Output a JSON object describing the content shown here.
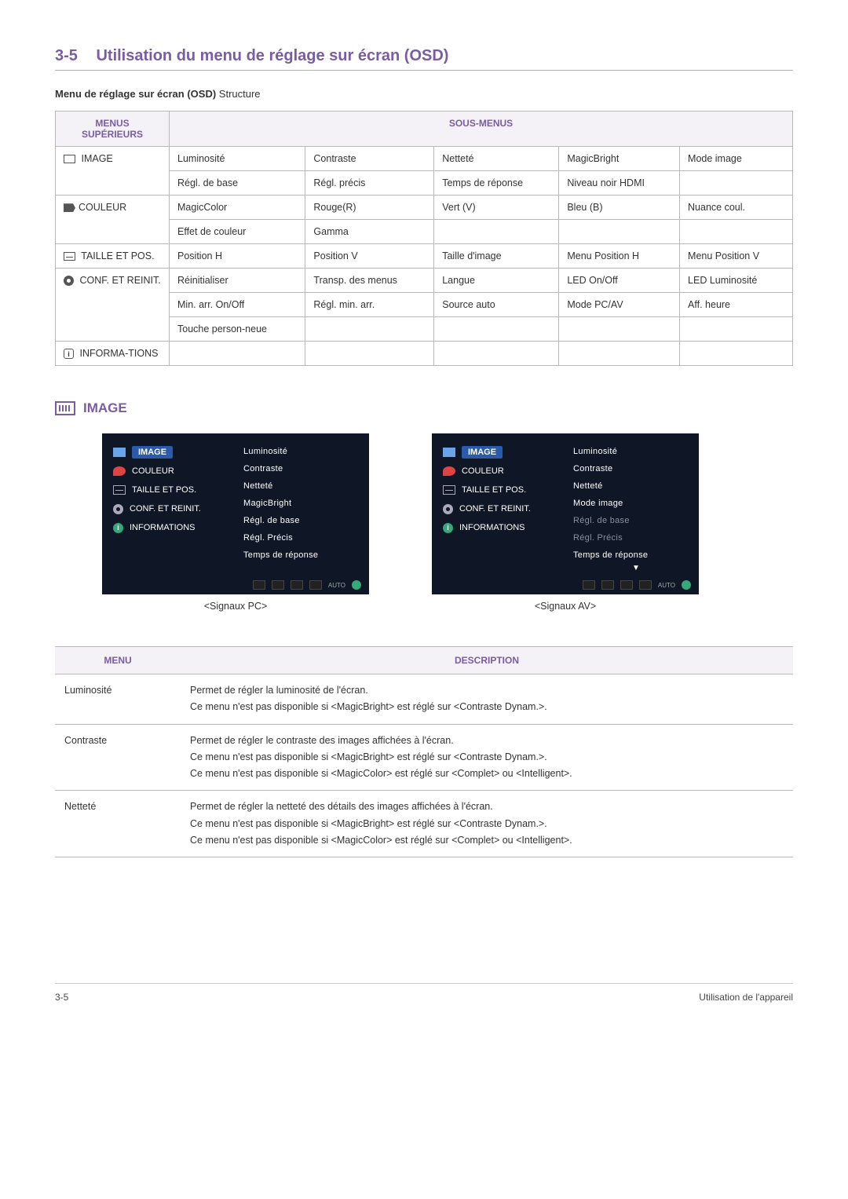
{
  "section": {
    "number": "3-5",
    "title": "Utilisation du menu de réglage sur écran (OSD)"
  },
  "sub_heading_bold": "Menu de réglage sur écran (OSD)",
  "sub_heading_rest": " Structure",
  "struct_header1": "MENUS SUPÉRIEURS",
  "struct_header2": "SOUS-MENUS",
  "struct": {
    "image_label": " IMAGE",
    "image_rows": [
      [
        "Luminosité",
        "Contraste",
        "Netteté",
        "MagicBright",
        "Mode image"
      ],
      [
        "Régl. de base",
        "Régl. précis",
        "Temps de réponse",
        "Niveau noir HDMI",
        ""
      ]
    ],
    "color_label": "COULEUR",
    "color_rows": [
      [
        "MagicColor",
        "Rouge(R)",
        "Vert (V)",
        "Bleu (B)",
        "Nuance coul."
      ],
      [
        "Effet de couleur",
        "Gamma",
        "",
        "",
        ""
      ]
    ],
    "size_label": " TAILLE ET POS.",
    "size_rows": [
      [
        "Position H",
        "Position V",
        "Taille d'image",
        "Menu Position H",
        "Menu Position V"
      ]
    ],
    "conf_label": " CONF. ET REINIT.",
    "conf_rows": [
      [
        "Réinitialiser",
        "Transp. des menus",
        "Langue",
        "LED On/Off",
        "LED Luminosité"
      ],
      [
        "Min. arr. On/Off",
        "Régl. min. arr.",
        "Source auto",
        "Mode PC/AV",
        "Aff. heure"
      ],
      [
        "Touche person-neue",
        "",
        "",
        "",
        ""
      ]
    ],
    "info_label": " INFORMA-TIONS",
    "info_rows": [
      [
        "",
        "",
        "",
        "",
        ""
      ]
    ]
  },
  "image_section_heading": "IMAGE",
  "osd": {
    "menu_image": "IMAGE",
    "menu_couleur": "COULEUR",
    "menu_taille": "TAILLE ET POS.",
    "menu_conf": "CONF. ET REINIT.",
    "menu_info": "INFORMATIONS",
    "pc_items": [
      "Luminosité",
      "Contraste",
      "Netteté",
      "MagicBright",
      "Régl. de base",
      "Régl. Précis",
      "Temps de réponse"
    ],
    "av_items": [
      "Luminosité",
      "Contraste",
      "Netteté",
      "Mode image",
      "Régl. de base",
      "Régl. Précis",
      "Temps de réponse"
    ],
    "av_dim_indexes": [
      4,
      5
    ],
    "caption_pc": "<Signaux PC>",
    "caption_av": "<Signaux AV>",
    "footer_auto": "AUTO"
  },
  "desc_header1": "MENU",
  "desc_header2": "DESCRIPTION",
  "desc_rows": [
    {
      "menu": "Luminosité",
      "lines": [
        "Permet de régler la luminosité de l'écran.",
        "Ce menu n'est pas disponible si <MagicBright> est réglé sur <Contraste Dynam.>."
      ]
    },
    {
      "menu": "Contraste",
      "lines": [
        "Permet de régler le contraste des images affichées à l'écran.",
        "Ce menu n'est pas disponible si <MagicBright> est réglé sur <Contraste Dynam.>.",
        "Ce menu n'est pas disponible si <MagicColor> est réglé sur <Complet> ou <Intelligent>."
      ]
    },
    {
      "menu": "Netteté",
      "lines": [
        "Permet de régler la netteté des détails des images affichées à l'écran.",
        "Ce menu n'est pas disponible si <MagicBright> est réglé sur <Contraste Dynam.>.",
        "Ce menu n'est pas disponible si <MagicColor> est réglé sur <Complet> ou <Intelligent>."
      ]
    }
  ],
  "footer": {
    "left": "3-5",
    "right": "Utilisation de l'appareil"
  }
}
